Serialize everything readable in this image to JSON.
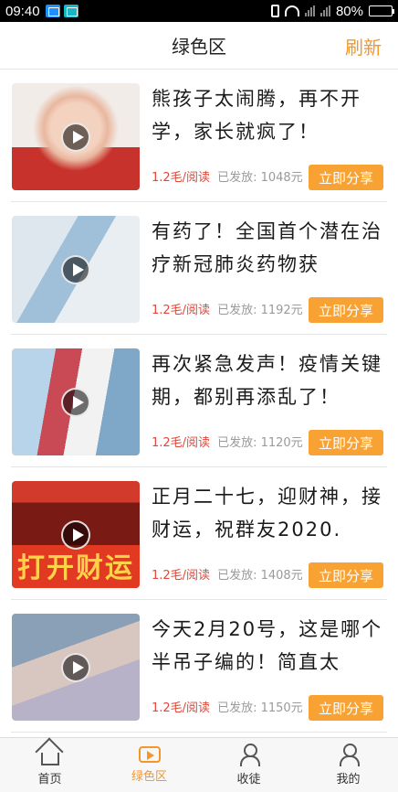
{
  "status_bar": {
    "time": "09:40",
    "battery": "80%",
    "battery_level": 0.8
  },
  "header": {
    "title": "绿色区",
    "refresh_label": "刷新"
  },
  "feed": {
    "items": [
      {
        "title": "熊孩子太闹腾，再不开学，家长就疯了！",
        "rate": "1.2毛/阅读",
        "sent": "已发放: 1048元",
        "share": "立即分享"
      },
      {
        "title": "有药了！全国首个潜在治疗新冠肺炎药物获",
        "rate": "1.2毛/阅读",
        "sent": "已发放: 1192元",
        "share": "立即分享"
      },
      {
        "title": "再次紧急发声！疫情关键期，都别再添乱了！",
        "rate": "1.2毛/阅读",
        "sent": "已发放: 1120元",
        "share": "立即分享"
      },
      {
        "title": "正月二十七，迎财神，接财运，祝群友2020.",
        "rate": "1.2毛/阅读",
        "sent": "已发放: 1408元",
        "share": "立即分享",
        "thumb_text": "打开财运"
      },
      {
        "title": "今天2月20号，这是哪个半吊子编的！简直太",
        "rate": "1.2毛/阅读",
        "sent": "已发放: 1150元",
        "share": "立即分享"
      }
    ]
  },
  "tabs": [
    {
      "label": "首页",
      "icon": "home-icon"
    },
    {
      "label": "绿色区",
      "icon": "video-play-icon",
      "active": true
    },
    {
      "label": "收徒",
      "icon": "user-arrow-icon"
    },
    {
      "label": "我的",
      "icon": "profile-icon"
    }
  ],
  "colors": {
    "accent": "#f5962a",
    "button": "#f7a233",
    "rate": "#e0483a"
  }
}
